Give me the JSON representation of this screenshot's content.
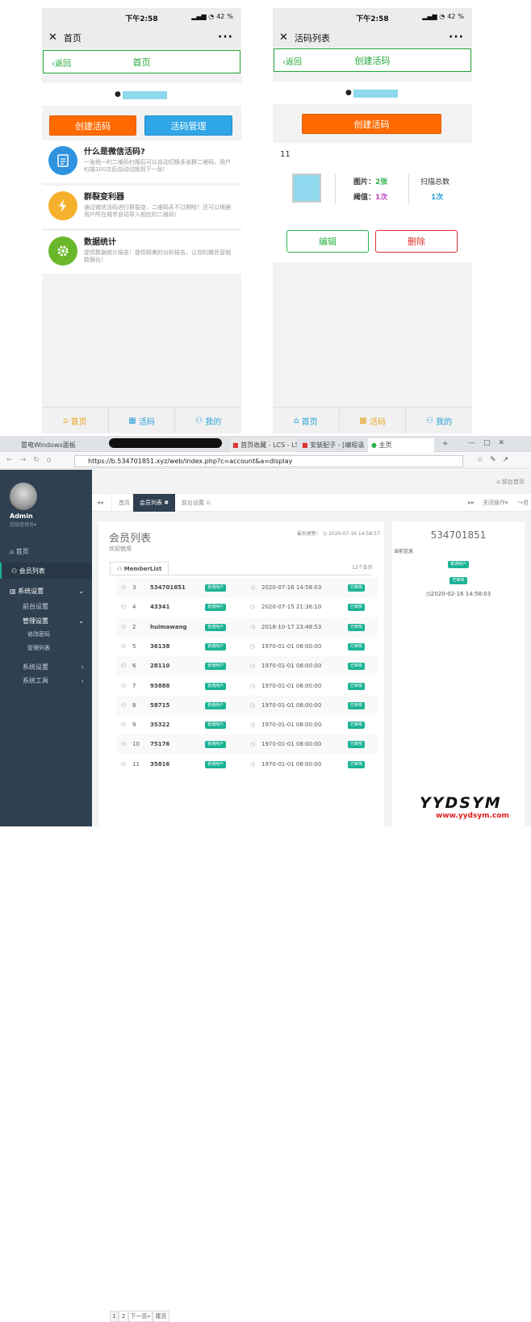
{
  "phone_left": {
    "time": "下午2:58",
    "battery": "42",
    "page_title": "首页",
    "back": "返回",
    "header": "首页",
    "btn_create": "创建活码",
    "btn_manage": "活码管理",
    "features": [
      {
        "title": "什么是微信活码?",
        "desc": "一张统一的二维码扫描后可以自动切换多张群二维码。用户扫描100次后自动切换到下一张!"
      },
      {
        "title": "群裂变利器",
        "desc": "通过微信活码进行群裂变，二维码永不过期啦！还可以根据用户所在城市自动导入相应的二维码！"
      },
      {
        "title": "数据统计",
        "desc": "提供数据统计报告！提供精美的分析报告，让你的微信营销数据化！"
      }
    ],
    "tabs": [
      "首页",
      "活码",
      "我的"
    ]
  },
  "phone_right": {
    "time": "下午2:58",
    "battery": "42",
    "page_title": "活码列表",
    "back": "返回",
    "header": "创建活码",
    "btn_create": "创建活码",
    "item_name": "11",
    "pic_label": "图片：",
    "pic_value": "2张",
    "thr_label": "阈值：",
    "thr_value": "1次",
    "scan_label": "扫描总数",
    "scan_value": "1次",
    "edit": "编辑",
    "delete": "删除",
    "tabs": [
      "首页",
      "活码",
      "我的"
    ]
  },
  "browser": {
    "tabs": [
      "雷电Windows面板",
      "首页收藏 - LCS - LSc",
      "安装配子 - [编程语",
      "主页"
    ],
    "url": "https://b.534701851.xyz/web/index.php?c=account&a=display"
  },
  "admin": {
    "user": "Admin",
    "role": "超级管理员▾",
    "top_link": "前台首页",
    "menu": [
      "首页",
      "会员列表",
      "系统设置",
      "前台设置",
      "管理设置",
      "修改密码",
      "管理列表",
      "系统设置",
      "系统工具"
    ],
    "tabs": [
      "首页",
      "会员列表",
      "前台设置"
    ],
    "close_ops": "关闭操作▾",
    "exit": "退",
    "page_title": "会员列表",
    "welcome": "欢迎使用",
    "last_update_label": "最后更新：",
    "last_update": "2020-07-16 14:58:57",
    "list_tab": "MemberList",
    "count": "12个会员",
    "rows": [
      {
        "n": "3",
        "name": "534701851",
        "tag": "普通用户",
        "time": "2020-07-16 14:58:03",
        "st": "已审核"
      },
      {
        "n": "4",
        "name": "43341",
        "tag": "普通用户",
        "time": "2020-07-15 21:36:10",
        "st": "已审核"
      },
      {
        "n": "2",
        "name": "huimawang",
        "tag": "普通用户",
        "time": "2018-10-17 23:48:53",
        "st": "已审核"
      },
      {
        "n": "5",
        "name": "36138",
        "tag": "普通用户",
        "time": "1970-01-01 08:00:00",
        "st": "已审核"
      },
      {
        "n": "6",
        "name": "28110",
        "tag": "普通用户",
        "time": "1970-01-01 08:00:00",
        "st": "已审核"
      },
      {
        "n": "7",
        "name": "93888",
        "tag": "普通用户",
        "time": "1970-01-01 08:00:00",
        "st": "已审核"
      },
      {
        "n": "8",
        "name": "58715",
        "tag": "普通用户",
        "time": "1970-01-01 08:00:00",
        "st": "已审核"
      },
      {
        "n": "9",
        "name": "35322",
        "tag": "普通用户",
        "time": "1970-01-01 08:00:00",
        "st": "已审核"
      },
      {
        "n": "10",
        "name": "75176",
        "tag": "普通用户",
        "time": "1970-01-01 08:00:00",
        "st": "已审核"
      },
      {
        "n": "11",
        "name": "35816",
        "tag": "普通用户",
        "time": "1970-01-01 08:00:00",
        "st": "已审核"
      }
    ],
    "pager": [
      "1",
      "2",
      "下一页»",
      "尾页"
    ],
    "detail": {
      "title": "534701851",
      "info_label": "当前信息",
      "tag": "普通用户",
      "status": "已审核",
      "time": "2020-02-16 14:58:03"
    }
  },
  "watermark": {
    "brand": "YYDSYM",
    "site": "www.yydsym.com"
  }
}
